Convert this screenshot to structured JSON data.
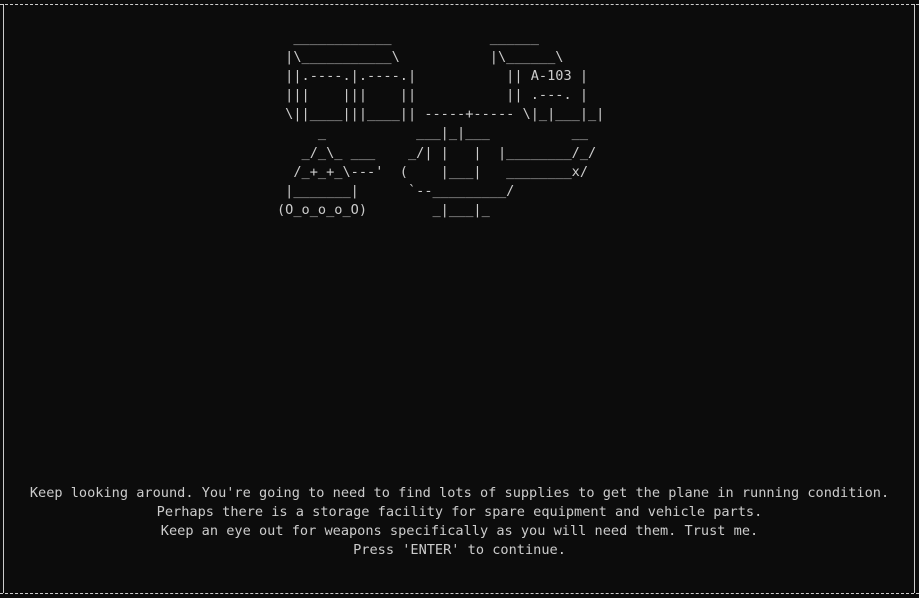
{
  "ascii_art": "  ____________            ______\n |\\___________\\           |\\______\\\n ||.----.|.----.|           || A-103 |\n |||    |||    ||           || .---. |\n \\||____|||____|| -----+----- \\|_|___|_|\n     _           ___|_|___          __\n   _/_\\_ ___    _/| |   |  |________/_/\n  /_+_+_\\---'  (    |___|   ________x/\n |_______|      `--_________/\n(O_o_o_o_O)        _|___|_",
  "messages": [
    "Keep looking around. You're going to need to find lots of supplies to get the plane in running condition.",
    "Perhaps there is a storage facility for spare equipment and vehicle parts.",
    "Keep an eye out for weapons specifically as you will need them. Trust me.",
    "Press 'ENTER' to continue."
  ],
  "colors": {
    "background": "#0c0c0c",
    "foreground": "#cccccc"
  }
}
